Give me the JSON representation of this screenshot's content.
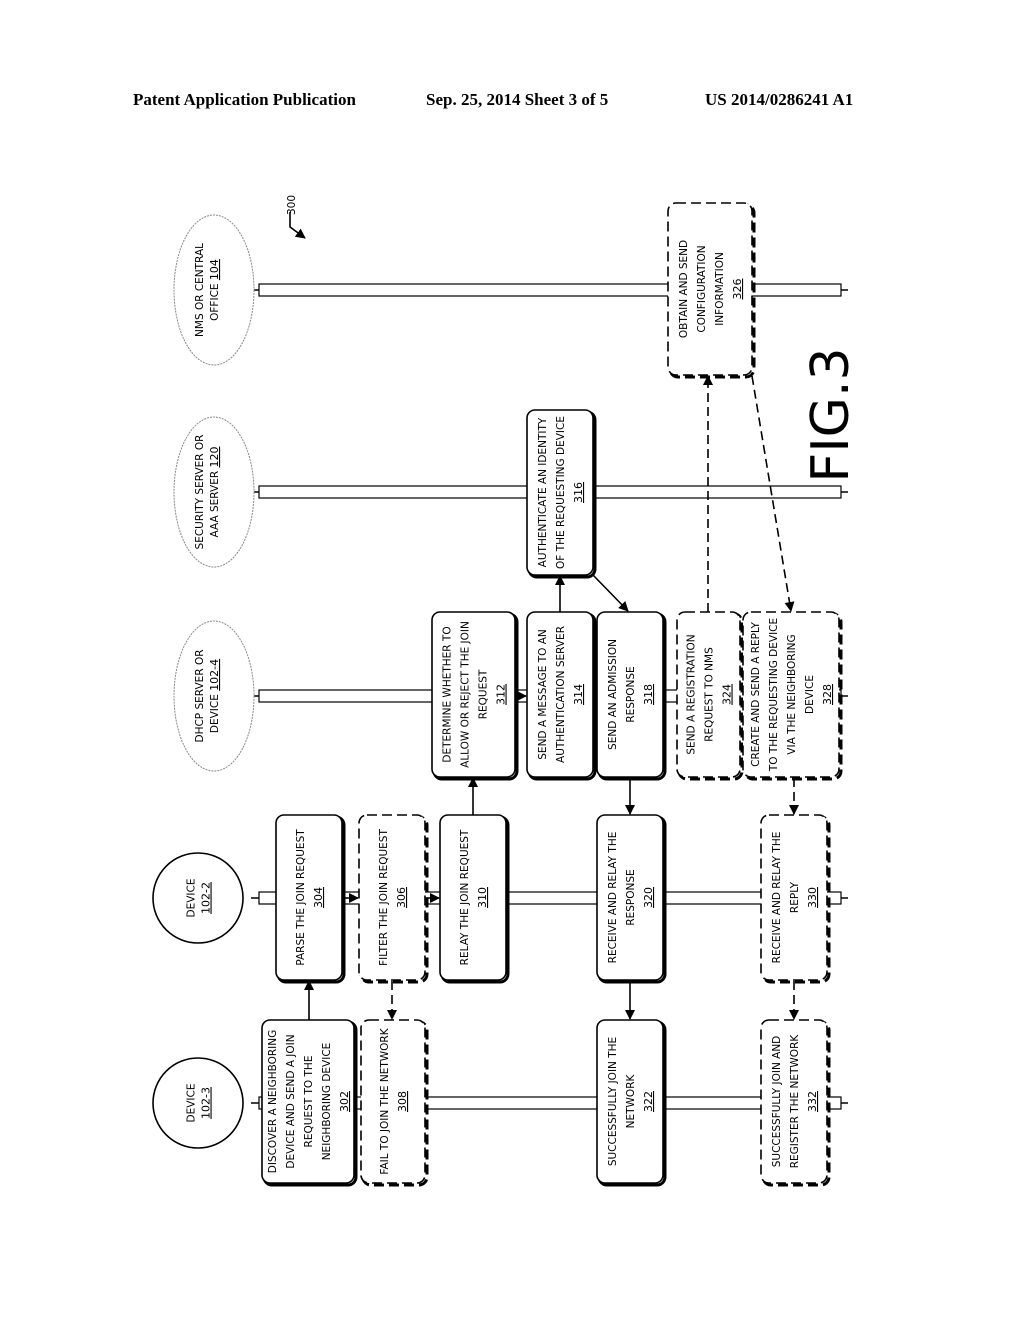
{
  "header": {
    "publication": "Patent Application Publication",
    "date_sheet": "Sep. 25, 2014   Sheet 3 of 5",
    "patent_number": "US 2014/0286241 A1"
  },
  "figure": {
    "label": "FIG.3",
    "reference": "300"
  },
  "entities": [
    {
      "id": "device-102-3",
      "lines": [
        "DEVICE"
      ],
      "ref": "102-3",
      "shape": "circle"
    },
    {
      "id": "device-102-2",
      "lines": [
        "DEVICE"
      ],
      "ref": "102-2",
      "shape": "circle"
    },
    {
      "id": "dhcp-server",
      "lines": [
        "DHCP SERVER OR",
        "DEVICE"
      ],
      "ref": "102-4",
      "shape": "ellipse"
    },
    {
      "id": "security-server",
      "lines": [
        "SECURITY SERVER OR",
        "AAA SERVER"
      ],
      "ref": "120",
      "shape": "ellipse"
    },
    {
      "id": "nms",
      "lines": [
        "NMS OR CENTRAL",
        "OFFICE"
      ],
      "ref": "104",
      "shape": "ellipse"
    }
  ],
  "steps": [
    {
      "ref": "302",
      "lines": [
        "DISCOVER A NEIGHBORING",
        "DEVICE AND SEND A JOIN",
        "REQUEST TO THE",
        "NEIGHBORING DEVICE"
      ],
      "optional": false
    },
    {
      "ref": "304",
      "lines": [
        "PARSE THE JOIN REQUEST"
      ],
      "optional": false
    },
    {
      "ref": "306",
      "lines": [
        "FILTER THE JOIN REQUEST"
      ],
      "optional": true
    },
    {
      "ref": "308",
      "lines": [
        "FAIL TO JOIN THE NETWORK"
      ],
      "optional": true
    },
    {
      "ref": "310",
      "lines": [
        "RELAY THE JOIN REQUEST"
      ],
      "optional": false
    },
    {
      "ref": "312",
      "lines": [
        "DETERMINE WHETHER TO",
        "ALLOW OR REJECT THE JOIN",
        "REQUEST"
      ],
      "optional": false
    },
    {
      "ref": "314",
      "lines": [
        "SEND A MESSAGE TO AN",
        "AUTHENTICATION SERVER"
      ],
      "optional": false
    },
    {
      "ref": "316",
      "lines": [
        "AUTHENTICATE AN IDENTITY",
        "OF THE REQUESTING DEVICE"
      ],
      "optional": false
    },
    {
      "ref": "318",
      "lines": [
        "SEND AN ADMISSION",
        "RESPONSE"
      ],
      "optional": false
    },
    {
      "ref": "320",
      "lines": [
        "RECEIVE AND RELAY THE",
        "RESPONSE"
      ],
      "optional": false
    },
    {
      "ref": "322",
      "lines": [
        "SUCCESSFULLY JOIN THE",
        "NETWORK"
      ],
      "optional": false
    },
    {
      "ref": "324",
      "lines": [
        "SEND A REGISTRATION",
        "REQUEST TO NMS"
      ],
      "optional": true
    },
    {
      "ref": "326",
      "lines": [
        "OBTAIN AND SEND",
        "CONFIGURATION",
        "INFORMATION"
      ],
      "optional": true
    },
    {
      "ref": "328",
      "lines": [
        "CREATE AND SEND A REPLY",
        "TO THE REQUESTING DEVICE",
        "VIA THE NEIGHBORING",
        "DEVICE"
      ],
      "optional": true
    },
    {
      "ref": "330",
      "lines": [
        "RECEIVE AND RELAY THE",
        "REPLY"
      ],
      "optional": true
    },
    {
      "ref": "332",
      "lines": [
        "SUCCESSFULLY JOIN AND",
        "REGISTER THE NETWORK"
      ],
      "optional": true
    }
  ],
  "flows": [
    {
      "from": "302",
      "to": "304",
      "optional": false
    },
    {
      "from": "304",
      "to": "306",
      "optional": false
    },
    {
      "from": "306",
      "to": "308",
      "optional": true
    },
    {
      "from": "306",
      "to": "310",
      "optional": false
    },
    {
      "from": "310",
      "to": "312",
      "optional": false
    },
    {
      "from": "312",
      "to": "314",
      "optional": false
    },
    {
      "from": "314",
      "to": "316",
      "optional": false
    },
    {
      "from": "316",
      "to": "318",
      "optional": false
    },
    {
      "from": "318",
      "to": "320",
      "optional": false
    },
    {
      "from": "320",
      "to": "322",
      "optional": false
    },
    {
      "from": "324",
      "to": "326",
      "optional": true
    },
    {
      "from": "326",
      "to": "328",
      "optional": true
    },
    {
      "from": "328",
      "to": "330",
      "optional": true
    },
    {
      "from": "330",
      "to": "332",
      "optional": true
    }
  ]
}
